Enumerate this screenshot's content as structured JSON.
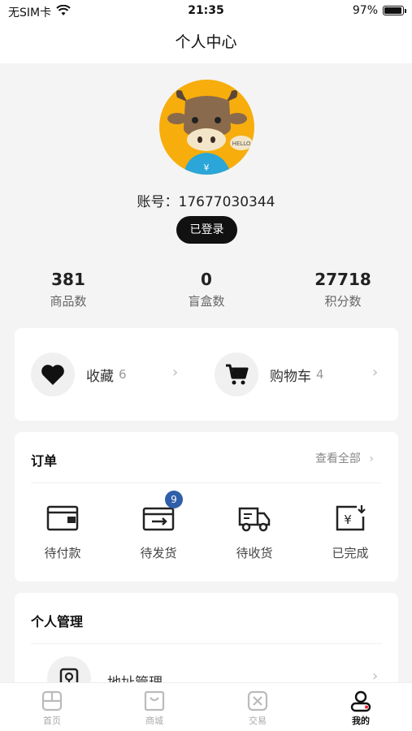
{
  "status_bar": {
    "carrier": "无SIM卡",
    "time": "21:35",
    "battery": "97%",
    "battery_level": 0.97
  },
  "nav": {
    "title": "个人中心"
  },
  "profile": {
    "account": "账号：17677030344",
    "login_status": "已登录"
  },
  "stats": [
    {
      "value": "381",
      "label": "商品数"
    },
    {
      "value": "0",
      "label": "盲盒数"
    },
    {
      "value": "27718",
      "label": "积分数"
    }
  ],
  "favorites": {
    "collect": {
      "label": "收藏",
      "count": "6"
    },
    "cart": {
      "label": "购物车",
      "count": "4"
    }
  },
  "orders": {
    "title": "订单",
    "view_all": "查看全部",
    "items": [
      {
        "label": "待付款",
        "icon": "wallet-icon"
      },
      {
        "label": "待发货",
        "icon": "shipping-box-icon",
        "badge": "9"
      },
      {
        "label": "待收货",
        "icon": "truck-icon"
      },
      {
        "label": "已完成",
        "icon": "completed-receipt-icon"
      }
    ]
  },
  "personal": {
    "title": "个人管理",
    "items": [
      {
        "label": "地址管理",
        "icon": "location-icon"
      }
    ]
  },
  "tab_bar": {
    "items": [
      {
        "label": "首页",
        "icon": "home-icon",
        "active": false
      },
      {
        "label": "商城",
        "icon": "mall-icon",
        "active": false
      },
      {
        "label": "交易",
        "icon": "trade-icon",
        "active": false
      },
      {
        "label": "我的",
        "icon": "profile-icon",
        "active": true
      }
    ]
  },
  "colors": {
    "accent": "#111111",
    "badge": "#2f5fa8",
    "avatar_bg": "#f7ad0c"
  }
}
